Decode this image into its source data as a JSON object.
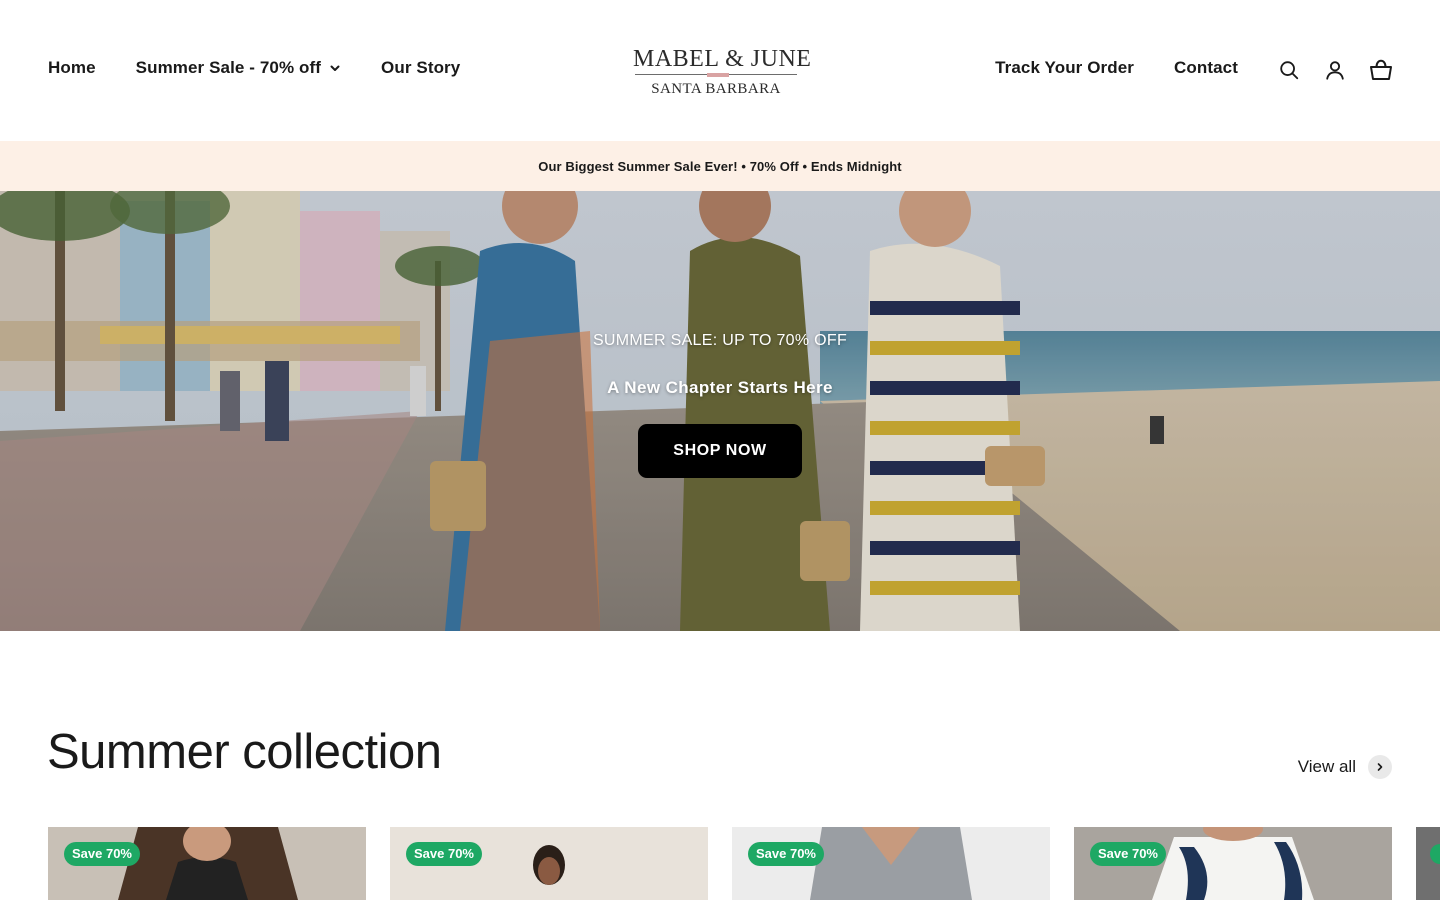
{
  "header": {
    "nav_left": [
      {
        "label": "Home"
      },
      {
        "label": "Summer Sale - 70% off",
        "has_dropdown": true
      },
      {
        "label": "Our Story"
      }
    ],
    "logo": {
      "line1": "MABEL & JUNE",
      "line2": "SANTA BARBARA"
    },
    "nav_right": [
      {
        "label": "Track Your Order"
      },
      {
        "label": "Contact"
      }
    ],
    "icons": [
      "search-icon",
      "account-icon",
      "cart-icon"
    ]
  },
  "announcement": {
    "text": "Our Biggest Summer Sale Ever! • 70% Off • Ends Midnight"
  },
  "hero": {
    "eyebrow": "SUMMER SALE: UP TO 70% OFF",
    "title": "A New Chapter Starts Here",
    "button_label": "SHOP NOW"
  },
  "collection": {
    "title": "Summer collection",
    "view_all_label": "View all",
    "products": [
      {
        "badge": "Save 70%"
      },
      {
        "badge": "Save 70%"
      },
      {
        "badge": "Save 70%"
      },
      {
        "badge": "Save 70%"
      },
      {
        "badge": ""
      }
    ]
  },
  "colors": {
    "announcement_bg": "#fdf0e6",
    "badge_bg": "#1ea864",
    "button_bg": "#000000",
    "text": "#1a1a1a"
  }
}
